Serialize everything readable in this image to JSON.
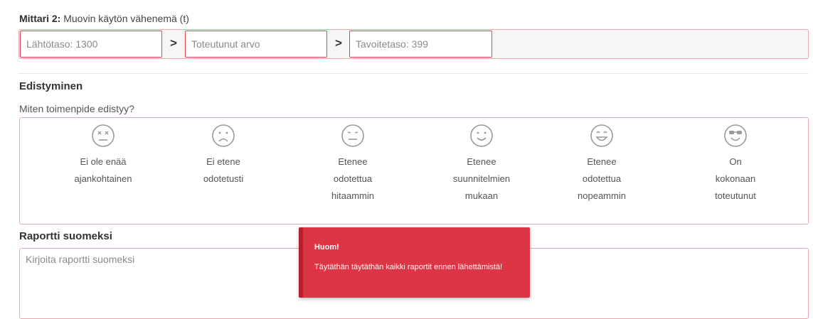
{
  "metric": {
    "label": "Mittari 2:",
    "description": "Muovin käytön vähenemä (t)",
    "baseline_placeholder": "Lähtötaso: 1300",
    "actual_placeholder": "Toteutunut arvo",
    "target_placeholder": "Tavoitetaso: 399",
    "arrow": ">"
  },
  "progress": {
    "title": "Edistyminen",
    "question": "Miten toimenpide edistyy?",
    "options": [
      {
        "icon": "dead-face-icon",
        "lines": [
          "Ei ole enää",
          "ajankohtainen"
        ]
      },
      {
        "icon": "sad-face-icon",
        "lines": [
          "Ei etene",
          "odotetusti"
        ]
      },
      {
        "icon": "neutral-face-icon",
        "lines": [
          "Etenee",
          "odotettua",
          "hitaammin"
        ]
      },
      {
        "icon": "smile-face-icon",
        "lines": [
          "Etenee",
          "suunnitelmien",
          "mukaan"
        ]
      },
      {
        "icon": "grin-face-icon",
        "lines": [
          "Etenee",
          "odotettua",
          "nopeammin"
        ]
      },
      {
        "icon": "cool-face-icon",
        "lines": [
          "On",
          "kokonaan",
          "toteutunut"
        ]
      }
    ]
  },
  "report": {
    "title": "Raportti suomeksi",
    "placeholder": "Kirjoita raportti suomeksi"
  },
  "toast": {
    "title": "Huom!",
    "message": "Täytäthän täytäthän kaikki raportit ennen lähettämistä!"
  },
  "colors": {
    "error_border": "#d8474f",
    "toast_bg": "#dc3545",
    "icon_stroke": "#9a9a9a"
  }
}
